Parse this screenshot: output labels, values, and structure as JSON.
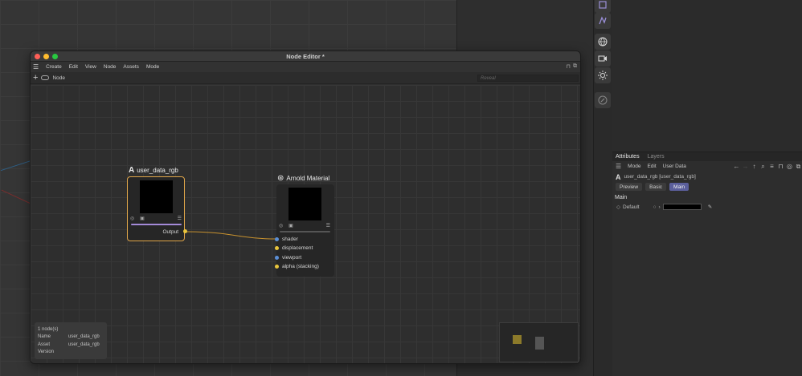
{
  "window": {
    "title": "Node Editor *",
    "menu": [
      "Create",
      "Edit",
      "View",
      "Node",
      "Assets",
      "Mode"
    ],
    "toolbar_label": "Node",
    "reveal_placeholder": "Reveal"
  },
  "nodes": {
    "user_data": {
      "title": "user_data_rgb",
      "output_label": "Output"
    },
    "arnold": {
      "title": "Arnold Material",
      "ports": [
        "shader",
        "displacement",
        "viewport",
        "alpha (stacking)"
      ]
    }
  },
  "info": {
    "count": "1 node(s)",
    "name_key": "Name",
    "name_value": "user_data_rgb",
    "asset_key": "Asset",
    "asset_value": "user_data_rgb",
    "version_key": "Version"
  },
  "attributes": {
    "tabs": [
      "Attributes",
      "Layers"
    ],
    "menu": [
      "Mode",
      "Edit",
      "User Data"
    ],
    "object": "user_data_rgb [user_data_rgb]",
    "buttons": [
      "Preview",
      "Basic",
      "Main"
    ],
    "section": "Main",
    "default_label": "Default"
  },
  "colors": {
    "accent": "#5b5f9c",
    "wire": "#c8922e",
    "port_blue": "#5b8fd6",
    "port_yellow": "#e8c53c"
  }
}
